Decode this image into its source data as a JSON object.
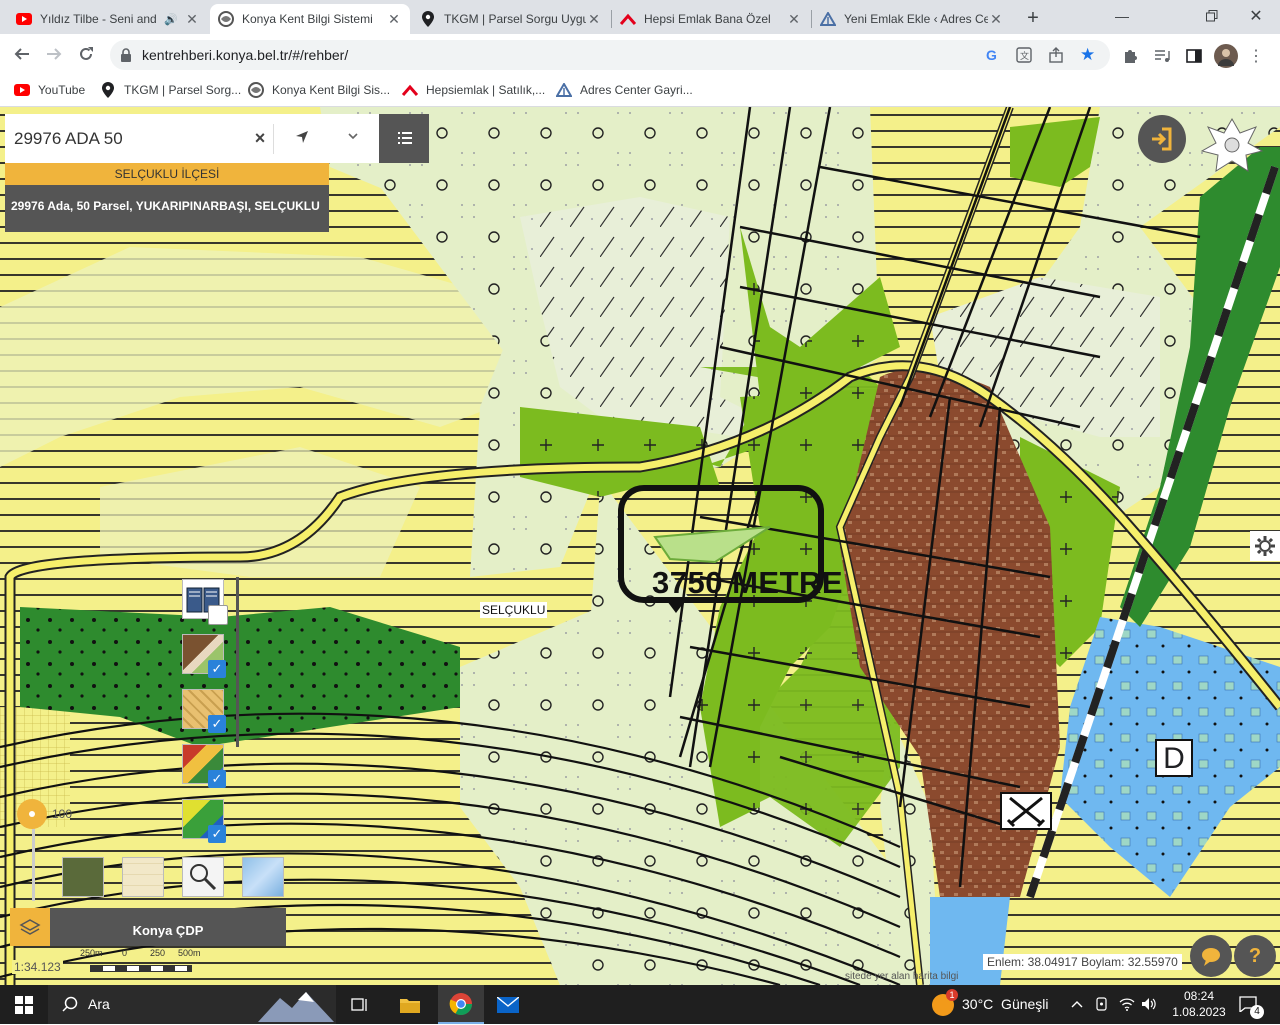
{
  "browser": {
    "tabs": [
      {
        "title": "Yıldız Tilbe - Seni and",
        "icon": "youtube-icon",
        "audio": true,
        "active": false
      },
      {
        "title": "Konya Kent Bilgi Sistemi",
        "icon": "konya-logo-icon",
        "active": true
      },
      {
        "title": "TKGM | Parsel Sorgu Uygu",
        "icon": "map-pin-icon",
        "active": false
      },
      {
        "title": "Hepsi Emlak Bana Özel",
        "icon": "hepsiemlak-icon",
        "active": false
      },
      {
        "title": "Yeni Emlak Ekle ‹ Adres Ce",
        "icon": "adres-center-icon",
        "active": false
      }
    ],
    "new_tab_symbol": "+",
    "url": "kentrehberi.konya.bel.tr/#/rehber/",
    "bookmarks": [
      {
        "label": "YouTube",
        "icon": "youtube-icon"
      },
      {
        "label": "TKGM | Parsel Sorg...",
        "icon": "map-pin-icon"
      },
      {
        "label": "Konya Kent Bilgi Sis...",
        "icon": "konya-logo-icon"
      },
      {
        "label": "Hepsiemlak | Satılık,...",
        "icon": "hepsiemlak-icon"
      },
      {
        "label": "Adres Center Gayri...",
        "icon": "adres-center-icon"
      }
    ]
  },
  "search": {
    "value": "29976 ADA 50",
    "clear_symbol": "×",
    "district_header": "SELÇUKLU İLÇESİ",
    "result": "29976 Ada, 50 Parsel, YUKARIPINARBAŞI, SELÇUKLU"
  },
  "map": {
    "annotation": "3750 METRE",
    "district_label": "SELÇUKLU",
    "marker_letter": "D",
    "opacity_value": "100",
    "layer_name": "Konya ÇDP",
    "scale": "1:34.123",
    "scale_ticks": [
      "250m",
      "0",
      "250",
      "500m"
    ],
    "coordinates": "Enlem: 38.04917 Boylam: 32.55970",
    "footer_note": "sitede yer alan harita bilgi",
    "help_symbol": "?"
  },
  "taskbar": {
    "search_label": "Ara",
    "weather": "30°C  Güneşli",
    "weather_badge": "1",
    "time": "08:24",
    "date": "1.08.2023",
    "notification_count": "4"
  },
  "colors": {
    "map_yellow": "#f4f08a",
    "map_light_green": "#e4efc8",
    "map_green": "#7cbb1f",
    "map_dark_green": "#2e8b2e",
    "map_brown": "#8b4a2e",
    "map_blue": "#6fb8f0",
    "panel_orange": "#f0b43c",
    "panel_gray": "#555555"
  }
}
